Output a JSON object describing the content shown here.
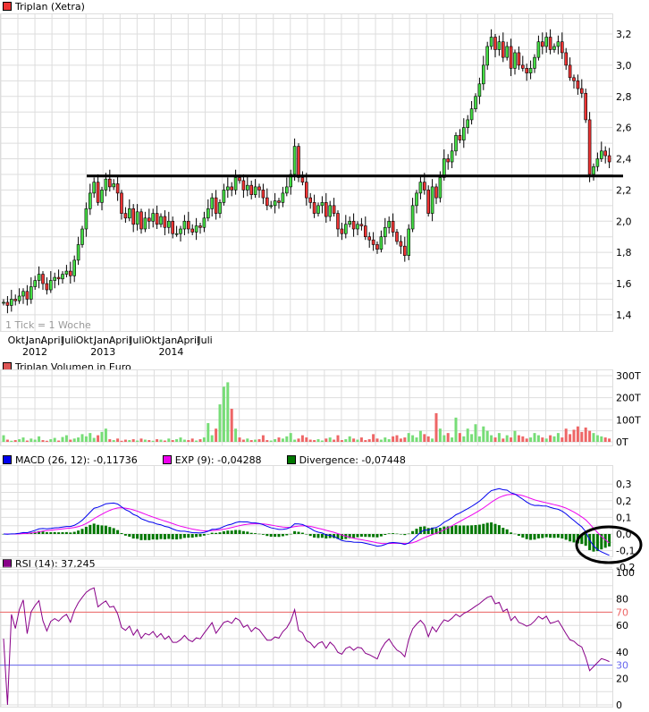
{
  "chart_data": [
    {
      "type": "candlestick",
      "title": "Triplan (Xetra)",
      "note": "1 Tick = 1 Woche",
      "legend_color": "#ee3333",
      "yticks": [
        "3,2",
        "3,0",
        "2,8",
        "2,6",
        "2,4",
        "2,2",
        "2,0",
        "1,8",
        "1,6",
        "1,4"
      ],
      "ylim": [
        1.35,
        3.35
      ],
      "xticks": [
        {
          "label": "Okt.",
          "year": ""
        },
        {
          "label": "Jan.",
          "year": "2012"
        },
        {
          "label": "April",
          "year": ""
        },
        {
          "label": "Juli",
          "year": ""
        },
        {
          "label": "Okt.",
          "year": ""
        },
        {
          "label": "Jan.",
          "year": "2013"
        },
        {
          "label": "April",
          "year": ""
        },
        {
          "label": "Juli",
          "year": ""
        },
        {
          "label": "Okt.",
          "year": ""
        },
        {
          "label": "Jan.",
          "year": "2014"
        },
        {
          "label": "April",
          "year": ""
        },
        {
          "label": "Juli",
          "year": ""
        }
      ],
      "support_line": 2.29,
      "up_color": "#44dd44",
      "down_color": "#ee3333",
      "closes": [
        1.48,
        1.46,
        1.5,
        1.49,
        1.52,
        1.55,
        1.5,
        1.58,
        1.62,
        1.66,
        1.6,
        1.56,
        1.62,
        1.64,
        1.63,
        1.66,
        1.68,
        1.65,
        1.75,
        1.85,
        1.95,
        2.08,
        2.18,
        2.25,
        2.12,
        2.2,
        2.27,
        2.22,
        2.24,
        2.18,
        2.05,
        2.02,
        2.08,
        1.98,
        2.06,
        1.95,
        2.02,
        2.0,
        2.05,
        1.98,
        2.03,
        1.96,
        2.0,
        1.92,
        1.92,
        1.95,
        2.0,
        1.95,
        1.93,
        1.97,
        1.96,
        2.02,
        2.08,
        2.15,
        2.05,
        2.12,
        2.2,
        2.22,
        2.2,
        2.28,
        2.26,
        2.2,
        2.23,
        2.17,
        2.22,
        2.2,
        2.15,
        2.1,
        2.1,
        2.13,
        2.12,
        2.18,
        2.22,
        2.3,
        2.48,
        2.28,
        2.25,
        2.15,
        2.12,
        2.05,
        2.1,
        2.12,
        2.03,
        2.1,
        2.05,
        1.95,
        1.92,
        1.98,
        2.0,
        1.95,
        1.98,
        1.97,
        1.9,
        1.88,
        1.85,
        1.82,
        1.9,
        1.96,
        2.0,
        1.93,
        1.87,
        1.84,
        1.78,
        1.95,
        2.1,
        2.18,
        2.25,
        2.2,
        2.05,
        2.22,
        2.15,
        2.28,
        2.4,
        2.38,
        2.45,
        2.55,
        2.52,
        2.6,
        2.65,
        2.72,
        2.8,
        2.88,
        3.0,
        3.12,
        3.18,
        3.1,
        3.15,
        3.05,
        3.12,
        2.98,
        3.08,
        3.0,
        2.98,
        2.95,
        2.98,
        3.05,
        3.15,
        3.12,
        3.18,
        3.1,
        3.12,
        3.15,
        3.08,
        3.0,
        2.92,
        2.9,
        2.85,
        2.82,
        2.65,
        2.3,
        2.35,
        2.4,
        2.45,
        2.42,
        2.38
      ]
    },
    {
      "type": "bar",
      "title": "Triplan Volumen in Euro",
      "legend_color": "#dd5555",
      "yticks": [
        "300T",
        "200T",
        "100T",
        "0T"
      ],
      "ylim": [
        0,
        300
      ],
      "unit": "T",
      "values": [
        30,
        10,
        5,
        8,
        12,
        20,
        6,
        15,
        10,
        25,
        8,
        5,
        12,
        18,
        6,
        22,
        30,
        10,
        15,
        20,
        35,
        25,
        40,
        18,
        30,
        45,
        60,
        12,
        8,
        15,
        5,
        10,
        8,
        12,
        6,
        15,
        10,
        8,
        5,
        12,
        10,
        6,
        15,
        8,
        12,
        20,
        10,
        8,
        15,
        6,
        12,
        20,
        85,
        30,
        60,
        170,
        250,
        270,
        150,
        60,
        20,
        10,
        15,
        8,
        10,
        12,
        30,
        8,
        6,
        12,
        20,
        15,
        25,
        40,
        10,
        15,
        30,
        20,
        10,
        8,
        12,
        6,
        15,
        20,
        10,
        30,
        8,
        12,
        25,
        15,
        10,
        20,
        8,
        12,
        35,
        15,
        10,
        20,
        12,
        25,
        30,
        15,
        20,
        40,
        30,
        20,
        50,
        35,
        25,
        15,
        130,
        60,
        30,
        40,
        20,
        110,
        40,
        25,
        60,
        35,
        80,
        25,
        70,
        50,
        30,
        20,
        40,
        15,
        30,
        20,
        50,
        30,
        25,
        15,
        20,
        40,
        30,
        20,
        15,
        30,
        25,
        40,
        20,
        60,
        35,
        55,
        70,
        45,
        65,
        50,
        40,
        30,
        25,
        20,
        15
      ]
    },
    {
      "type": "line",
      "legend": [
        {
          "label": "MACD (26, 12): -0,11736",
          "color": "#0000ee"
        },
        {
          "label": "EXP (9): -0,04288",
          "color": "#ee00ee"
        },
        {
          "label": "Divergence: -0,07448",
          "color": "#007700"
        }
      ],
      "yticks": [
        "0,3",
        "0,2",
        "0,1",
        "0,0",
        "-0,1",
        "-0,2"
      ],
      "ylim": [
        -0.2,
        0.3
      ]
    },
    {
      "type": "line",
      "legend": [
        {
          "label": "RSI (14): 37,245",
          "color": "#880088"
        }
      ],
      "yticks": [
        "100",
        "80",
        "70",
        "60",
        "40",
        "30",
        "20",
        "0"
      ],
      "ylim": [
        0,
        100
      ],
      "overbought": 70,
      "oversold": 30,
      "overbought_color": "#ee6666",
      "oversold_color": "#6666ee"
    }
  ]
}
